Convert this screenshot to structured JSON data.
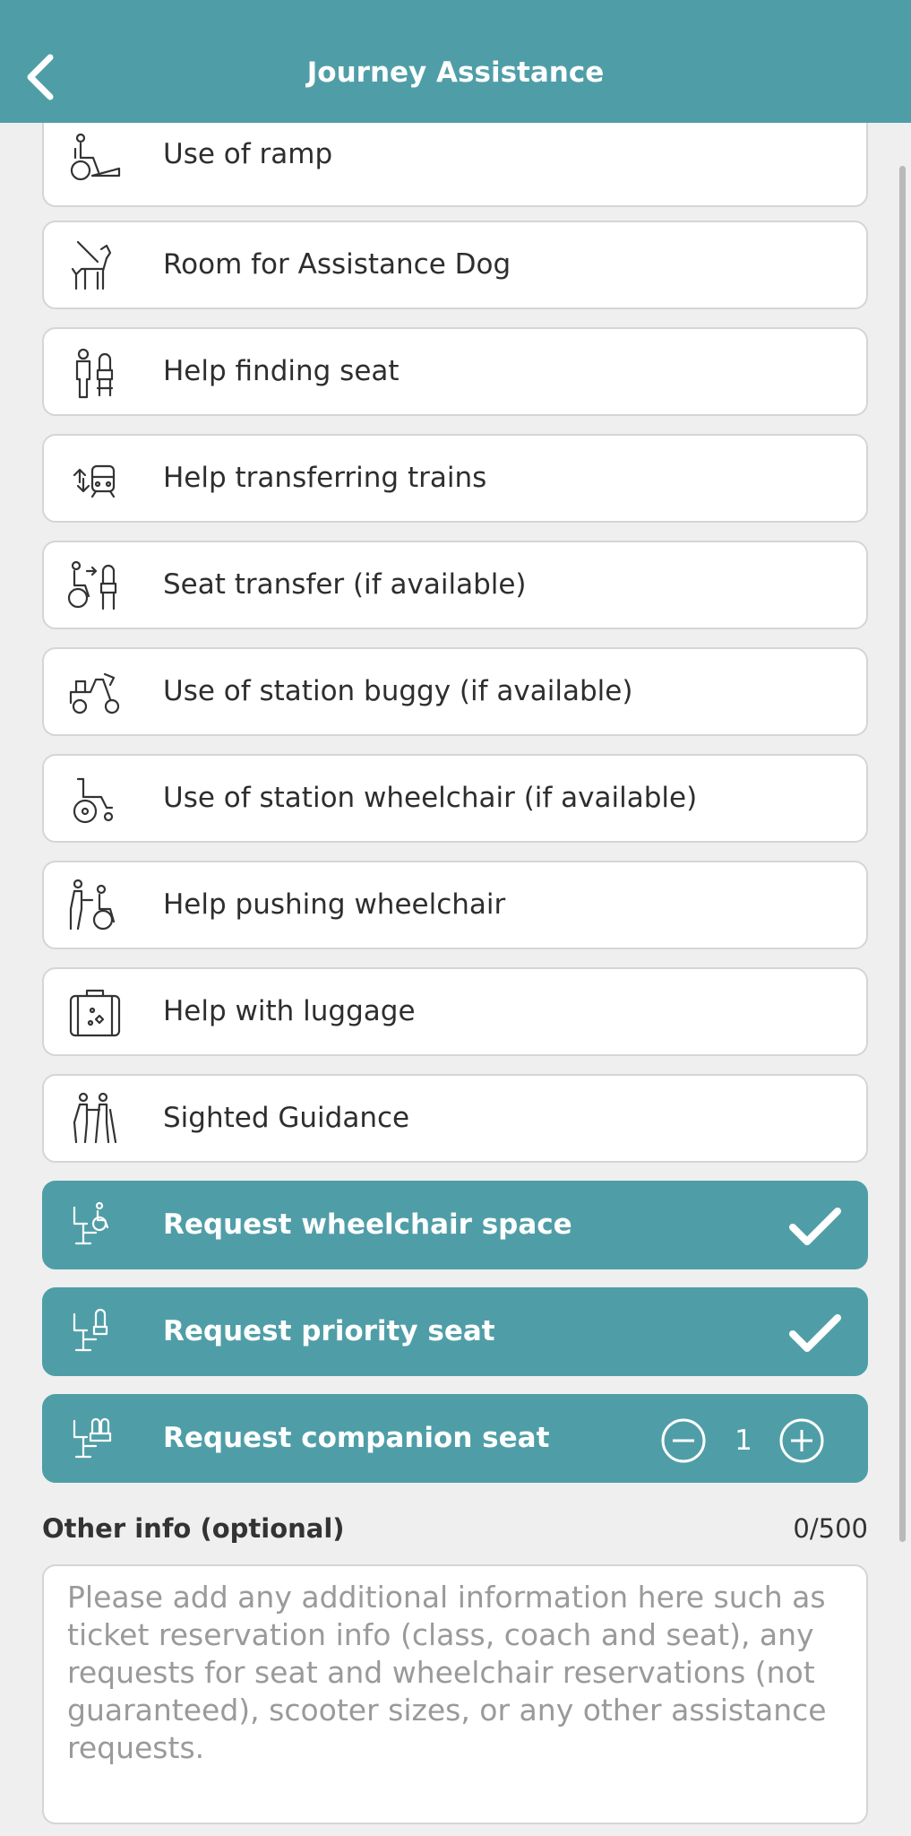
{
  "header": {
    "title": "Journey Assistance"
  },
  "options": [
    {
      "label": "Use of ramp",
      "icon": "ramp-icon",
      "selected": false
    },
    {
      "label": "Room for Assistance Dog",
      "icon": "assistance-dog-icon",
      "selected": false
    },
    {
      "label": "Help finding seat",
      "icon": "finding-seat-icon",
      "selected": false
    },
    {
      "label": "Help transferring trains",
      "icon": "transfer-trains-icon",
      "selected": false
    },
    {
      "label": "Seat transfer (if available)",
      "icon": "seat-transfer-icon",
      "selected": false
    },
    {
      "label": "Use of station buggy (if available)",
      "icon": "station-buggy-icon",
      "selected": false
    },
    {
      "label": "Use of station wheelchair (if available)",
      "icon": "station-wheelchair-icon",
      "selected": false
    },
    {
      "label": "Help pushing wheelchair",
      "icon": "pushing-wheelchair-icon",
      "selected": false
    },
    {
      "label": "Help with luggage",
      "icon": "luggage-icon",
      "selected": false
    },
    {
      "label": "Sighted Guidance",
      "icon": "sighted-guidance-icon",
      "selected": false
    }
  ],
  "requests": [
    {
      "label": "Request wheelchair space",
      "icon": "wheelchair-space-icon",
      "selected": true
    },
    {
      "label": "Request priority seat",
      "icon": "priority-seat-icon",
      "selected": true
    },
    {
      "label": "Request companion seat",
      "icon": "companion-seat-icon",
      "count": "1"
    }
  ],
  "other_info": {
    "label": "Other info (optional)",
    "counter": "0/500",
    "placeholder": "Please add any additional information here such as ticket reservation info (class, coach and seat), any requests for seat and wheelchair reservations (not guaranteed), scooter sizes, or any other assistance requests."
  },
  "colors": {
    "header": "#4f9ea7",
    "selected": "#4f9ea7",
    "background": "#efefef"
  }
}
